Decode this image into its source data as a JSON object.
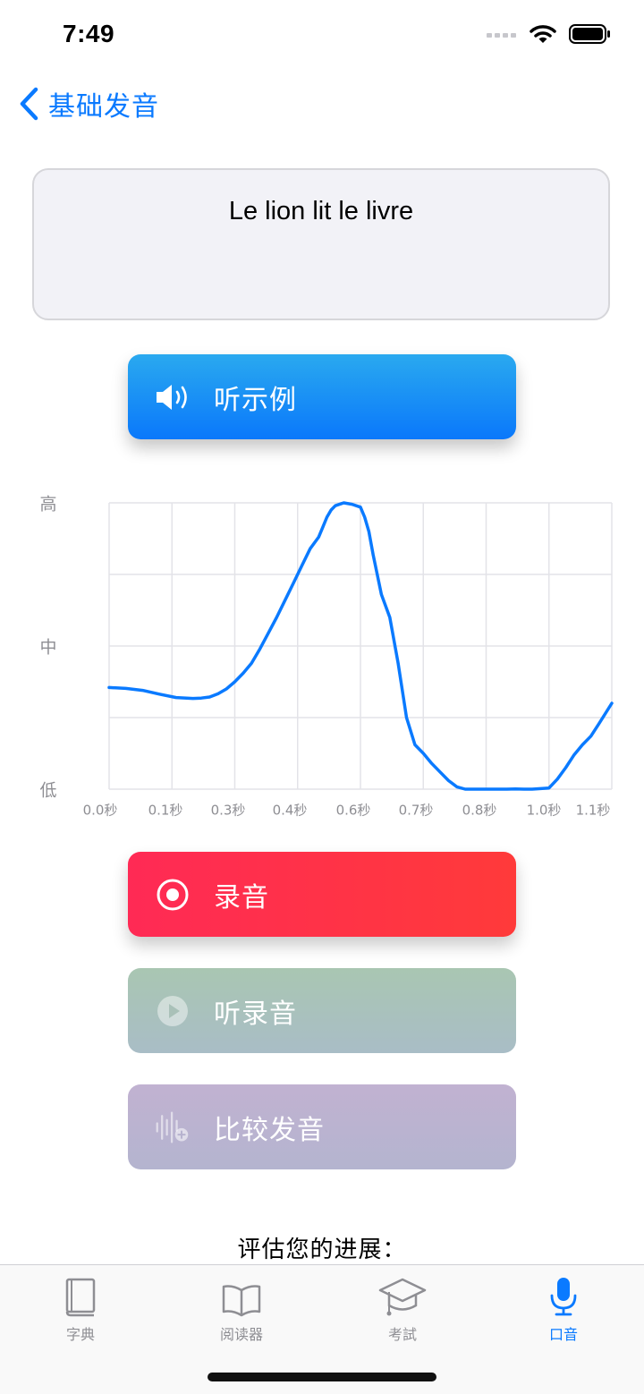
{
  "status_bar": {
    "time": "7:49"
  },
  "nav": {
    "back_label": "基础发音"
  },
  "phrase": {
    "text": "Le lion lit le livre"
  },
  "buttons": {
    "listen_example": "听示例",
    "record": "录音",
    "play_recording": "听录音",
    "compare": "比较发音"
  },
  "chart_data": {
    "type": "line",
    "x_tick_labels": [
      "0.0秒",
      "0.1秒",
      "0.3秒",
      "0.4秒",
      "0.6秒",
      "0.7秒",
      "0.8秒",
      "1.0秒",
      "1.1秒"
    ],
    "y_tick_labels": [
      "高",
      "中",
      "低"
    ],
    "xlim": [
      0.0,
      1.2
    ],
    "ylim": [
      0,
      1
    ],
    "grid": true,
    "series": [
      {
        "color": "#0a7aff",
        "x": [
          0.0,
          0.04,
          0.08,
          0.12,
          0.16,
          0.2,
          0.22,
          0.24,
          0.26,
          0.28,
          0.3,
          0.32,
          0.34,
          0.36,
          0.38,
          0.4,
          0.42,
          0.44,
          0.46,
          0.48,
          0.5,
          0.51,
          0.52,
          0.53,
          0.54,
          0.56,
          0.58,
          0.6,
          0.61,
          0.62,
          0.63,
          0.65,
          0.67,
          0.69,
          0.71,
          0.73,
          0.75,
          0.77,
          0.79,
          0.81,
          0.83,
          0.85,
          0.87,
          0.89,
          0.91,
          0.93,
          0.95,
          0.97,
          0.99,
          1.01,
          1.03,
          1.05,
          1.07,
          1.09,
          1.11,
          1.13,
          1.15,
          1.17,
          1.2
        ],
        "y": [
          0.355,
          0.352,
          0.345,
          0.332,
          0.32,
          0.317,
          0.318,
          0.322,
          0.333,
          0.35,
          0.375,
          0.405,
          0.44,
          0.49,
          0.545,
          0.6,
          0.66,
          0.72,
          0.78,
          0.84,
          0.88,
          0.915,
          0.95,
          0.975,
          0.99,
          1.0,
          0.995,
          0.985,
          0.95,
          0.9,
          0.82,
          0.68,
          0.6,
          0.44,
          0.25,
          0.155,
          0.125,
          0.09,
          0.06,
          0.03,
          0.008,
          0.0,
          0.0,
          0.0,
          0.0,
          0.0,
          0.0,
          0.001,
          0.0,
          0.0,
          0.002,
          0.004,
          0.035,
          0.075,
          0.12,
          0.155,
          0.185,
          0.23,
          0.3
        ]
      }
    ]
  },
  "progress": {
    "title": "评估您的进展："
  },
  "tabs": [
    {
      "label": "字典",
      "icon": "book-icon",
      "active": false
    },
    {
      "label": "阅读器",
      "icon": "open-book-icon",
      "active": false
    },
    {
      "label": "考試",
      "icon": "graduation-cap-icon",
      "active": false
    },
    {
      "label": "口音",
      "icon": "microphone-icon",
      "active": true
    }
  ],
  "colors": {
    "accent": "#0a7aff",
    "record": "#ff2d55",
    "card_bg": "#f2f2f7",
    "grid": "#e3e3e8",
    "axis_label": "#8e8e93"
  }
}
